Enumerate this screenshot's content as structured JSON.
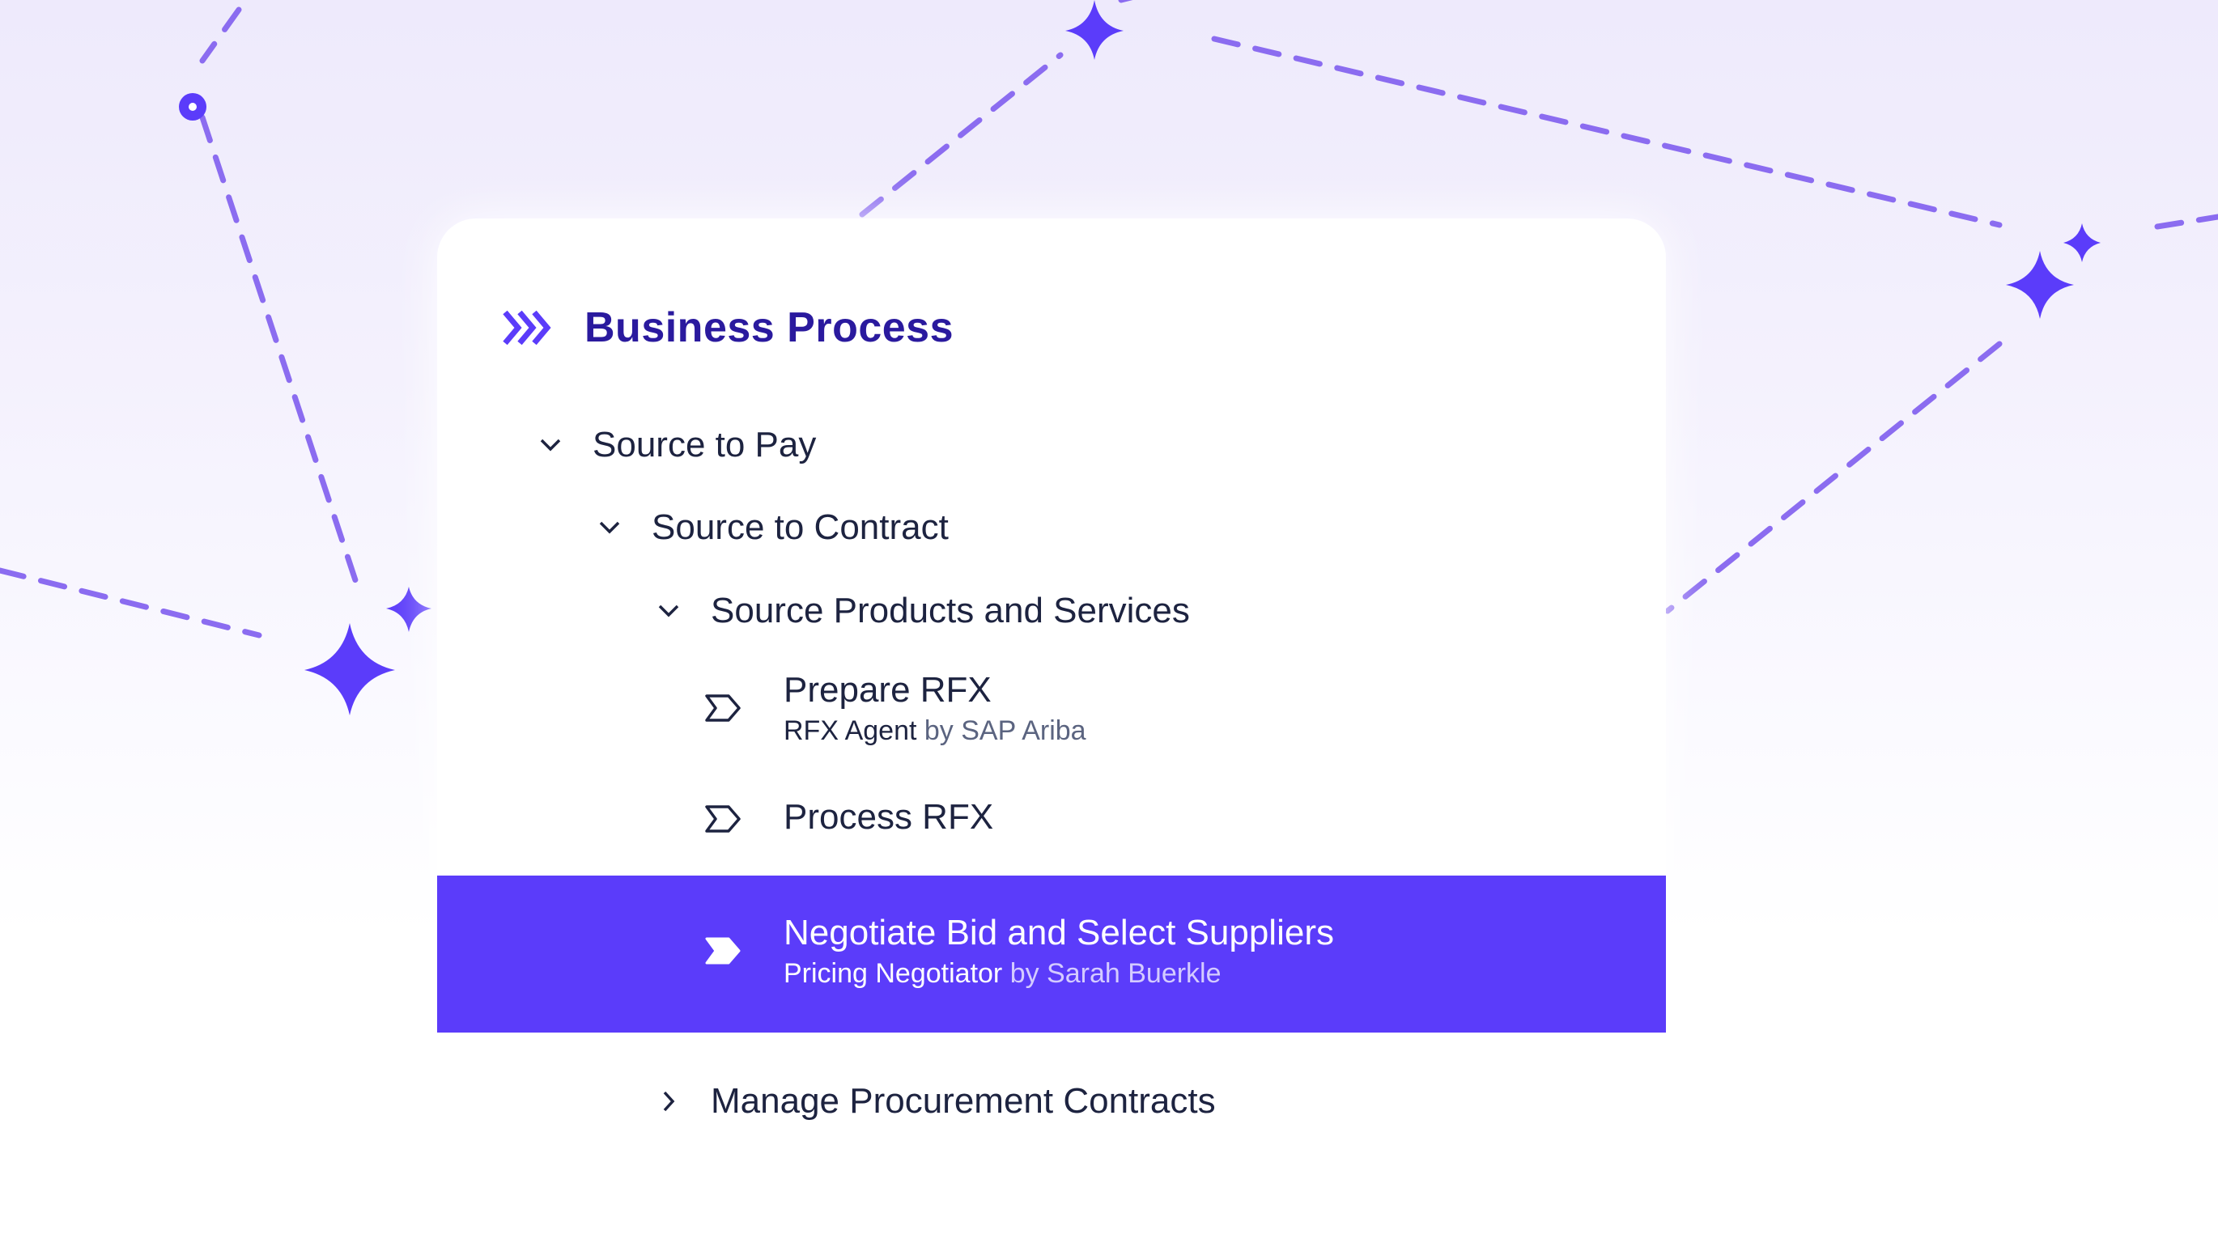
{
  "header": {
    "title": "Business Process",
    "icon": "triple-chevron-right-icon"
  },
  "colors": {
    "accent": "#5b3cfa",
    "title": "#2a1a9e",
    "text": "#1d2340",
    "muted": "#5b6480",
    "decoration": "#8b6cf0"
  },
  "tree": {
    "level1": {
      "label": "Source to Pay",
      "expanded": true
    },
    "level2": {
      "label": "Source to Contract",
      "expanded": true
    },
    "level3": {
      "label": "Source Products and Services",
      "expanded": true
    },
    "items": [
      {
        "title": "Prepare RFX",
        "agent": "RFX Agent",
        "by": "by SAP Ariba",
        "selected": false
      },
      {
        "title": "Process RFX",
        "selected": false
      },
      {
        "title": "Negotiate Bid and Select Suppliers",
        "agent": "Pricing Negotiator",
        "by": "by Sarah Buerkle",
        "selected": true
      }
    ],
    "collapsed": {
      "label": "Manage Procurement Contracts",
      "expanded": false
    }
  }
}
